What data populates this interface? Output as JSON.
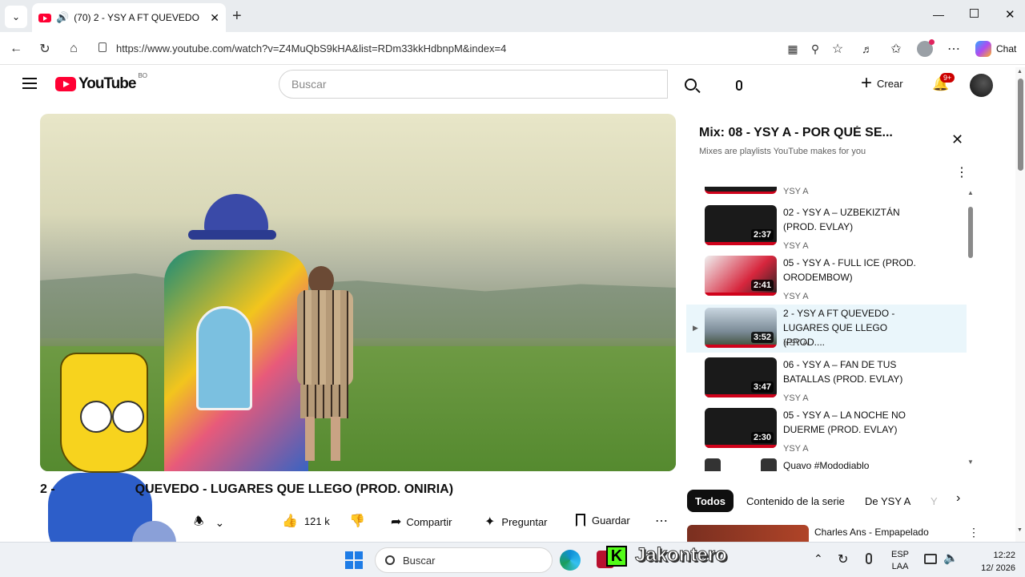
{
  "browser": {
    "tab_title": "(70) 2 - YSY A FT QUEVEDO -",
    "url": "https://www.youtube.com/watch?v=Z4MuQbS9kHA&list=RDm33kkHdbnpM&index=4",
    "chat_label": "Chat"
  },
  "youtube": {
    "logo_text": "YouTube",
    "region": "BO",
    "search_placeholder": "Buscar",
    "create_label": "Crear",
    "notifications_badge": "9+"
  },
  "video": {
    "title_visible": "QUEVEDO - LUGARES QUE LLEGO (PROD. ONIRIA)",
    "title_prefix": "2 -",
    "likes": "121 k",
    "share_label": "Compartir",
    "ask_label": "Preguntar",
    "save_label": "Guardar"
  },
  "playlist": {
    "title": "Mix: 08 - YSY A - POR QUÉ SE...",
    "subtitle": "Mixes are playlists YouTube makes for you",
    "partial_channel": "YSY A",
    "items": [
      {
        "title": "02 - YSY A – UZBEKIZTÁN (PROD. EVLAY)",
        "channel": "YSY A",
        "duration": "2:37",
        "current": false
      },
      {
        "title": "05 - YSY A - FULL ICE (PROD. ORODEMBOW)",
        "channel": "YSY A",
        "duration": "2:41",
        "current": false
      },
      {
        "title": "2 - YSY A FT QUEVEDO - LUGARES QUE LLEGO (PROD....",
        "channel": "YSY A",
        "duration": "3:52",
        "current": true
      },
      {
        "title": "06 - YSY A – FAN DE TUS BATALLAS (PROD. EVLAY)",
        "channel": "YSY A",
        "duration": "3:47",
        "current": false
      },
      {
        "title": "05 - YSY A – LA NOCHE NO DUERME (PROD. EVLAY)",
        "channel": "YSY A",
        "duration": "2:30",
        "current": false
      }
    ],
    "next_item_title": "Quavo #Mododiablo"
  },
  "chips": [
    "Todos",
    "Contenido de la serie",
    "De YSY A",
    "Y"
  ],
  "recommendation": {
    "title": "Charles Ans - Empapelado"
  },
  "taskbar": {
    "search_placeholder": "Buscar",
    "overlay_text": "Jakontero",
    "lang_top": "ESP",
    "lang_bottom": "LAA",
    "time": "12:22",
    "date": "12/  2026"
  },
  "colors": {
    "accent_red": "#ff0033",
    "playing_bg": "#eaf6fb"
  }
}
